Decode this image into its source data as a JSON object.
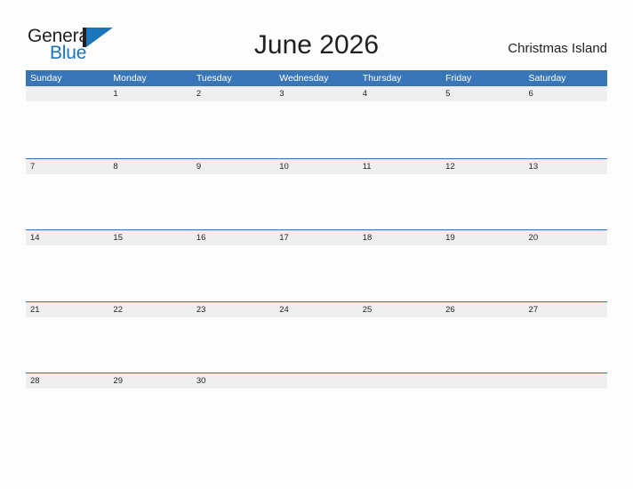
{
  "brand": {
    "name_part1": "General",
    "name_part2": "Blue",
    "color_dark": "#231f20",
    "color_blue": "#1b75bb"
  },
  "header": {
    "title": "June 2026",
    "location": "Christmas Island"
  },
  "theme": {
    "header_blue": "#3876b8",
    "band_gray": "#efefef",
    "band_border": "#2f6cb0",
    "text": "#231f20",
    "page_bg": "#fdfdfd"
  },
  "calendar": {
    "month": "June",
    "year": "2026",
    "weekdays": [
      "Sunday",
      "Monday",
      "Tuesday",
      "Wednesday",
      "Thursday",
      "Friday",
      "Saturday"
    ],
    "weeks": [
      {
        "days": [
          "",
          "1",
          "2",
          "3",
          "4",
          "5",
          "6"
        ]
      },
      {
        "days": [
          "7",
          "8",
          "9",
          "10",
          "11",
          "12",
          "13"
        ]
      },
      {
        "days": [
          "14",
          "15",
          "16",
          "17",
          "18",
          "19",
          "20"
        ]
      },
      {
        "days": [
          "21",
          "22",
          "23",
          "24",
          "25",
          "26",
          "27"
        ]
      },
      {
        "days": [
          "28",
          "29",
          "30",
          "",
          "",
          "",
          ""
        ]
      }
    ]
  }
}
